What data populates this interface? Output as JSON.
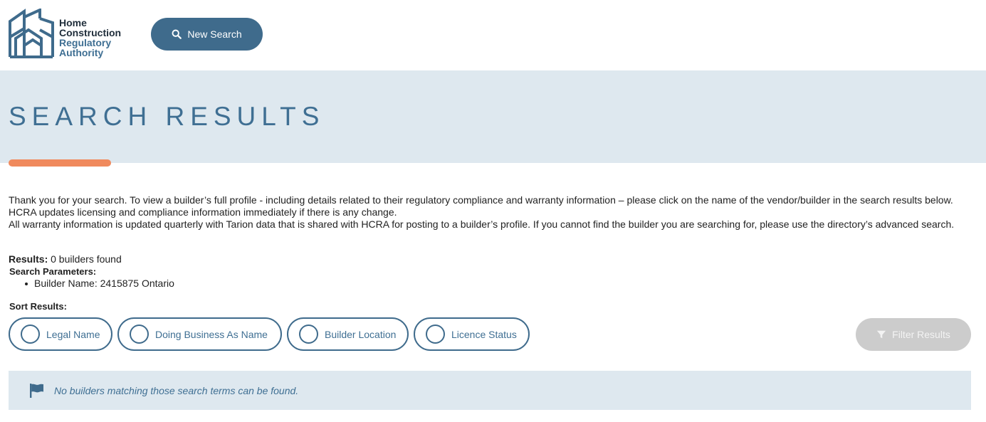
{
  "brand": {
    "logo_line1": "Home",
    "logo_line2": "Construction",
    "logo_line3": "Regulatory",
    "logo_line4": "Authority",
    "icon": "building-logo-icon",
    "dark_color": "#1f2d3a",
    "accent_blue": "#3f6f93"
  },
  "header": {
    "new_search_label": "New Search",
    "new_search_icon": "search-icon",
    "button_color": "#3f6b8c"
  },
  "hero": {
    "title": "SEARCH RESULTS",
    "band_color": "#dee8ef",
    "accent_color": "#f08a5d"
  },
  "intro": {
    "paragraph1": "Thank you for your search. To view a builder’s full profile - including details related to their regulatory compliance and warranty information – please click on the name of the vendor/builder in the search results below. HCRA updates licensing and compliance information immediately if there is any change.",
    "paragraph2": "All warranty information is updated quarterly with Tarion data that is shared with HCRA for posting to a builder’s profile. If you cannot find the builder you are searching for, please use the directory’s advanced search."
  },
  "results": {
    "label": "Results:",
    "value": "0 builders found",
    "params_label": "Search Parameters:",
    "params": [
      "Builder Name: 2415875 Ontario"
    ]
  },
  "sort": {
    "label": "Sort Results:",
    "options": [
      "Legal Name",
      "Doing Business As Name",
      "Builder Location",
      "Licence Status"
    ]
  },
  "filter": {
    "label": "Filter Results",
    "icon": "filter-icon",
    "disabled_color": "#cccccc"
  },
  "notice": {
    "icon": "flag-icon",
    "message": "No builders matching those search terms can be found."
  }
}
